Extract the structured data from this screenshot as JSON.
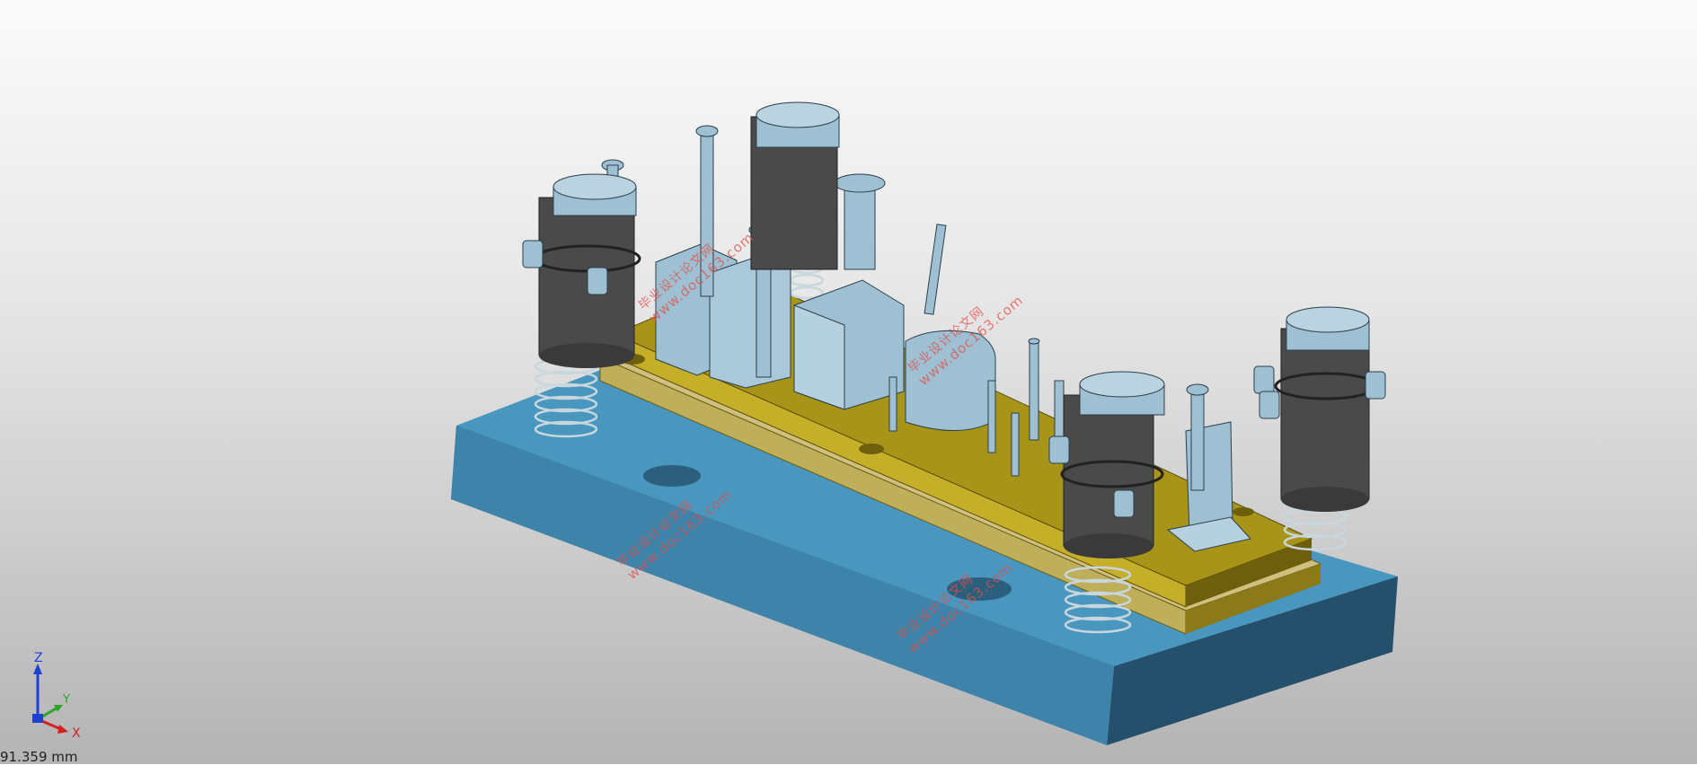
{
  "viewport": {
    "background_top": "#fbfbfb",
    "background_bottom": "#b4b4b4"
  },
  "model": {
    "base_plate_color": "#4996bf",
    "base_plate_side_color": "#2f6e92",
    "die_plate_color": "#a89418",
    "guide_sleeve_color": "#4a4a4a",
    "component_color": "#9ec0d2",
    "spring_color": "#c8d6de"
  },
  "triad": {
    "z_label": "Z",
    "y_label": "Y",
    "x_label": "X"
  },
  "scale_readout": "91.359 mm",
  "watermark": {
    "cn": "毕业设计论文网",
    "url": "www.doc163.com"
  }
}
